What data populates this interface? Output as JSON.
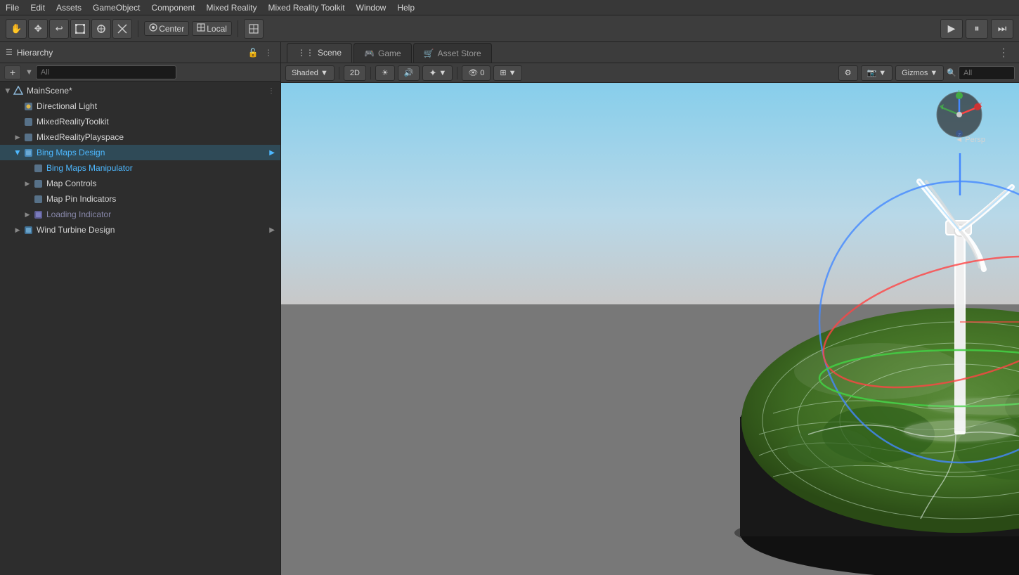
{
  "menubar": {
    "items": [
      "File",
      "Edit",
      "Assets",
      "GameObject",
      "Component",
      "Mixed Reality",
      "Mixed Reality Toolkit",
      "Window",
      "Help"
    ]
  },
  "toolbar": {
    "hand_tool": "✋",
    "move_tool": "✥",
    "undo": "↩",
    "rect_tool": "▣",
    "transform_tool": "⊕",
    "custom_tool": "✕",
    "center_label": "Center",
    "local_label": "Local",
    "pivot_tool": "⊞",
    "play": "▶",
    "pause": "⏸",
    "step": "⏭"
  },
  "hierarchy": {
    "title": "Hierarchy",
    "search_placeholder": "All",
    "add_btn": "+",
    "tree": [
      {
        "id": "mainscene",
        "label": "MainScene*",
        "indent": 0,
        "expanded": true,
        "icon": "scene",
        "selected": false,
        "options": true
      },
      {
        "id": "directional-light",
        "label": "Directional Light",
        "indent": 1,
        "icon": "sun",
        "selected": false
      },
      {
        "id": "mrtk",
        "label": "MixedRealityToolkit",
        "indent": 1,
        "icon": "cube",
        "selected": false
      },
      {
        "id": "mrplayspace",
        "label": "MixedRealityPlayspace",
        "indent": 1,
        "icon": "cube",
        "expanded": false,
        "selected": false
      },
      {
        "id": "bing-maps-design",
        "label": "Bing Maps Design",
        "indent": 1,
        "expanded": true,
        "icon": "cube-blue",
        "selected": true,
        "blue": true
      },
      {
        "id": "bing-maps-manip",
        "label": "Bing Maps Manipulator",
        "indent": 2,
        "icon": "cube",
        "selected": false,
        "blue": true
      },
      {
        "id": "map-controls",
        "label": "Map Controls",
        "indent": 2,
        "expanded": false,
        "icon": "cube",
        "selected": false
      },
      {
        "id": "map-pin",
        "label": "Map Pin Indicators",
        "indent": 2,
        "icon": "cube",
        "selected": false
      },
      {
        "id": "loading-indicator",
        "label": "Loading Indicator",
        "indent": 2,
        "icon": "cube-mixed",
        "selected": false,
        "disabled": true
      },
      {
        "id": "wind-turbine",
        "label": "Wind Turbine Design",
        "indent": 1,
        "expanded": false,
        "icon": "cube",
        "selected": false
      }
    ]
  },
  "scene_tabs": [
    {
      "label": "Scene",
      "icon": "⋮⋮",
      "active": true
    },
    {
      "label": "Game",
      "icon": "🎮",
      "active": false
    },
    {
      "label": "Asset Store",
      "icon": "🛒",
      "active": false
    }
  ],
  "scene_toolbar": {
    "shaded_label": "Shaded",
    "shaded_dropdown": true,
    "two_d_label": "2D",
    "audio_icon": "🔊",
    "fx_icon": "✦",
    "layer_icon": "⊞",
    "eye_num": "0",
    "grid_icon": "⊞",
    "gizmos_label": "Gizmos",
    "search_placeholder": "All"
  },
  "gizmo": {
    "persp_label": "◄ Persp"
  },
  "viewport": {
    "bg_sky_top": "#7ab8d4",
    "bg_sky_bottom": "#b8ccd8",
    "ground_color": "#7a7a7a"
  }
}
